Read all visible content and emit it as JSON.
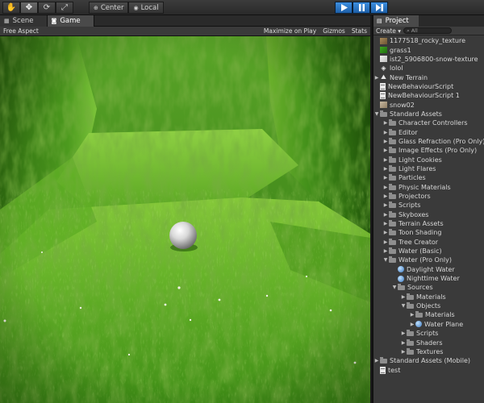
{
  "toolbar": {
    "pivot_label": "Center",
    "space_label": "Local"
  },
  "game_panel": {
    "tabs": [
      {
        "label": "Scene"
      },
      {
        "label": "Game"
      }
    ],
    "aspect": "Free Aspect",
    "options": [
      "Maximize on Play",
      "Gizmos",
      "Stats"
    ]
  },
  "project": {
    "tab_label": "Project",
    "create_label": "Create",
    "search_placeholder": "All",
    "items": [
      {
        "label": "1177518_rocky_texture",
        "icon": "texture-rock",
        "depth": 0,
        "arrow": ""
      },
      {
        "label": "grass1",
        "icon": "texture-grass",
        "depth": 0,
        "arrow": ""
      },
      {
        "label": "ist2_5906800-snow-texture",
        "icon": "texture-snow",
        "depth": 0,
        "arrow": ""
      },
      {
        "label": "lolol",
        "icon": "unity-scene",
        "depth": 0,
        "arrow": ""
      },
      {
        "label": "New Terrain",
        "icon": "terrain",
        "depth": 0,
        "arrow": "right"
      },
      {
        "label": "NewBehaviourScript",
        "icon": "script",
        "depth": 0,
        "arrow": ""
      },
      {
        "label": "NewBehaviourScript 1",
        "icon": "script",
        "depth": 0,
        "arrow": ""
      },
      {
        "label": "snow02",
        "icon": "texture-snow02",
        "depth": 0,
        "arrow": ""
      },
      {
        "label": "Standard Assets",
        "icon": "folder",
        "depth": 0,
        "arrow": "down"
      },
      {
        "label": "Character Controllers",
        "icon": "folder",
        "depth": 1,
        "arrow": "right"
      },
      {
        "label": "Editor",
        "icon": "folder",
        "depth": 1,
        "arrow": "right"
      },
      {
        "label": "Glass Refraction (Pro Only)",
        "icon": "folder",
        "depth": 1,
        "arrow": "right"
      },
      {
        "label": "Image Effects (Pro Only)",
        "icon": "folder",
        "depth": 1,
        "arrow": "right"
      },
      {
        "label": "Light Cookies",
        "icon": "folder",
        "depth": 1,
        "arrow": "right"
      },
      {
        "label": "Light Flares",
        "icon": "folder",
        "depth": 1,
        "arrow": "right"
      },
      {
        "label": "Particles",
        "icon": "folder",
        "depth": 1,
        "arrow": "right"
      },
      {
        "label": "Physic Materials",
        "icon": "folder",
        "depth": 1,
        "arrow": "right"
      },
      {
        "label": "Projectors",
        "icon": "folder",
        "depth": 1,
        "arrow": "right"
      },
      {
        "label": "Scripts",
        "icon": "folder",
        "depth": 1,
        "arrow": "right"
      },
      {
        "label": "Skyboxes",
        "icon": "folder",
        "depth": 1,
        "arrow": "right"
      },
      {
        "label": "Terrain Assets",
        "icon": "folder",
        "depth": 1,
        "arrow": "right"
      },
      {
        "label": "Toon Shading",
        "icon": "folder",
        "depth": 1,
        "arrow": "right"
      },
      {
        "label": "Tree Creator",
        "icon": "folder",
        "depth": 1,
        "arrow": "right"
      },
      {
        "label": "Water (Basic)",
        "icon": "folder",
        "depth": 1,
        "arrow": "right"
      },
      {
        "label": "Water (Pro Only)",
        "icon": "folder",
        "depth": 1,
        "arrow": "down"
      },
      {
        "label": "Daylight Water",
        "icon": "prefab",
        "depth": 2,
        "arrow": ""
      },
      {
        "label": "Nighttime Water",
        "icon": "prefab",
        "depth": 2,
        "arrow": ""
      },
      {
        "label": "Sources",
        "icon": "folder",
        "depth": 2,
        "arrow": "down"
      },
      {
        "label": "Materials",
        "icon": "folder",
        "depth": 3,
        "arrow": "right"
      },
      {
        "label": "Objects",
        "icon": "folder",
        "depth": 3,
        "arrow": "down"
      },
      {
        "label": "Materials",
        "icon": "folder",
        "depth": 4,
        "arrow": "right"
      },
      {
        "label": "Water Plane",
        "icon": "prefab",
        "depth": 4,
        "arrow": "right"
      },
      {
        "label": "Scripts",
        "icon": "folder",
        "depth": 3,
        "arrow": "right"
      },
      {
        "label": "Shaders",
        "icon": "folder",
        "depth": 3,
        "arrow": "right"
      },
      {
        "label": "Textures",
        "icon": "folder",
        "depth": 3,
        "arrow": "right"
      },
      {
        "label": "Standard Assets (Mobile)",
        "icon": "folder",
        "depth": 0,
        "arrow": "right"
      },
      {
        "label": "test",
        "icon": "script",
        "depth": 0,
        "arrow": ""
      }
    ]
  }
}
